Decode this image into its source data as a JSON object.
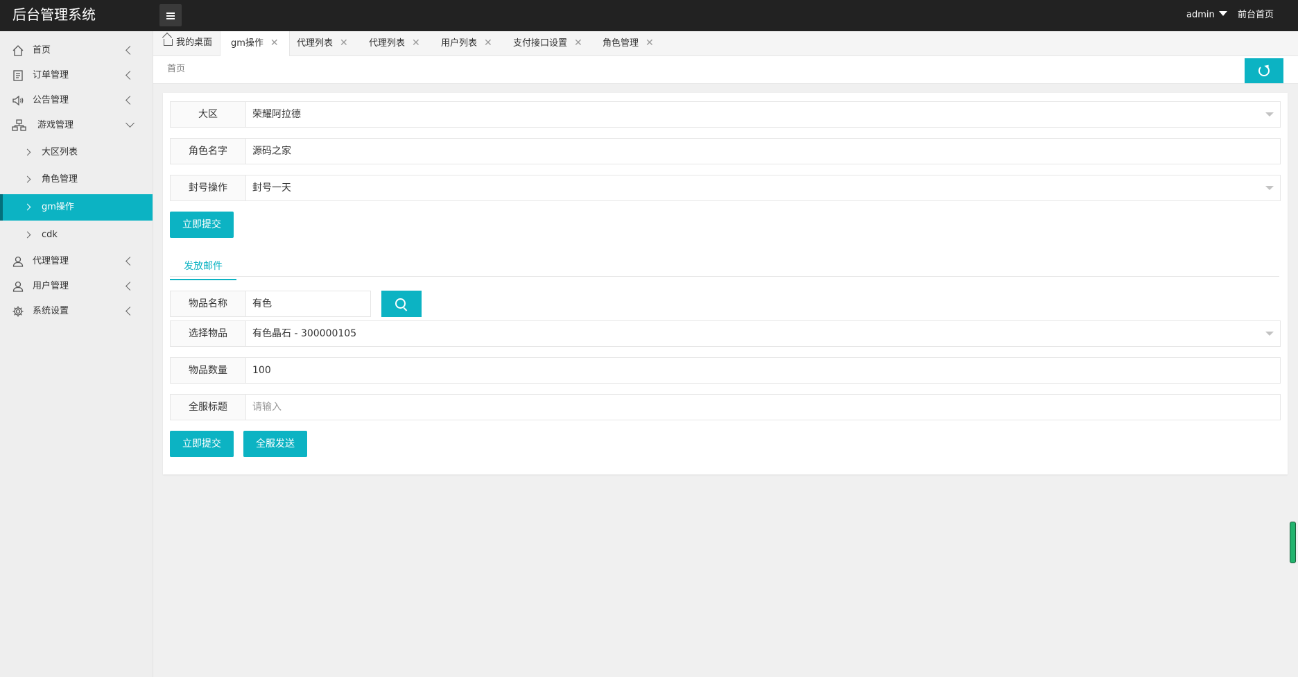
{
  "app": {
    "title": "后台管理系统"
  },
  "header": {
    "user": "admin",
    "home_link": "前台首页"
  },
  "sidebar": {
    "items": [
      {
        "label": "首页",
        "icon": "home-icon"
      },
      {
        "label": "订单管理",
        "icon": "document-icon"
      },
      {
        "label": "公告管理",
        "icon": "speaker-icon"
      },
      {
        "label": "游戏管理",
        "icon": "sitemap-icon",
        "expanded": true
      },
      {
        "label": "代理管理",
        "icon": "user-icon"
      },
      {
        "label": "用户管理",
        "icon": "user-icon"
      },
      {
        "label": "系统设置",
        "icon": "gear-icon"
      }
    ],
    "subitems": [
      {
        "label": "大区列表"
      },
      {
        "label": "角色管理"
      },
      {
        "label": "gm操作",
        "active": true
      },
      {
        "label": "cdk"
      }
    ]
  },
  "tabs": [
    {
      "label": "我的桌面"
    },
    {
      "label": "gm操作",
      "current": true
    },
    {
      "label": "代理列表"
    },
    {
      "label": "代理列表"
    },
    {
      "label": "用户列表"
    },
    {
      "label": "支付接口设置"
    },
    {
      "label": "角色管理"
    }
  ],
  "breadcrumb": "首页",
  "form": {
    "region": {
      "label": "大区",
      "value": "荣耀阿拉德"
    },
    "role_name": {
      "label": "角色名字",
      "value": "源码之家"
    },
    "ban": {
      "label": "封号操作",
      "value": "封号一天"
    },
    "submit": "立即提交"
  },
  "mail": {
    "tab": "发放邮件",
    "item_name": {
      "label": "物品名称",
      "value": "有色"
    },
    "select_item": {
      "label": "选择物品",
      "value": "有色晶石 - 300000105"
    },
    "quantity": {
      "label": "物品数量",
      "value": "100"
    },
    "server_title": {
      "label": "全服标题",
      "placeholder": "请输入"
    },
    "submit": "立即提交",
    "broadcast": "全服发送"
  },
  "colors": {
    "accent": "#0cb3c3",
    "topbar": "#222222"
  }
}
